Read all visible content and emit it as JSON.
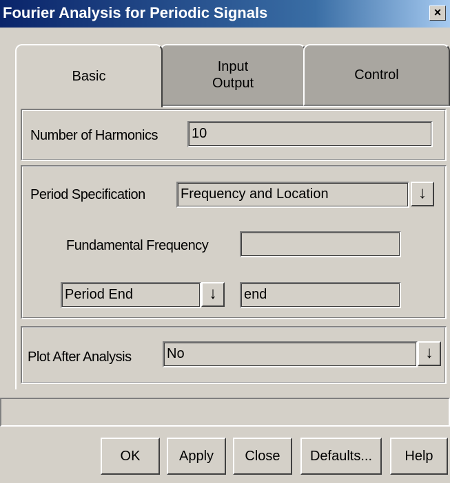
{
  "window": {
    "title": "Fourier Analysis for Periodic Signals",
    "close_glyph": "×"
  },
  "tabs": [
    {
      "label": "Basic"
    },
    {
      "label_line1": "Input",
      "label_line2": "Output"
    },
    {
      "label": "Control"
    }
  ],
  "harmonics": {
    "label": "Number of Harmonics",
    "value": "10"
  },
  "period": {
    "spec_label": "Period Specification",
    "spec_value": "Frequency and Location",
    "fundamental_label": "Fundamental Frequency",
    "fundamental_value": "",
    "end_select_value": "Period End",
    "end_value": "end"
  },
  "plot": {
    "label": "Plot After Analysis",
    "value": "No"
  },
  "status": {
    "text": ""
  },
  "buttons": {
    "ok": "OK",
    "apply": "Apply",
    "close": "Close",
    "defaults": "Defaults...",
    "help": "Help"
  },
  "icons": {
    "dropdown_arrow": "↓"
  }
}
